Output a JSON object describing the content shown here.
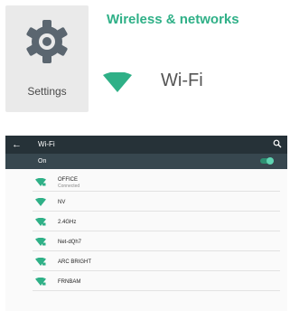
{
  "intro": {
    "settings_label": "Settings",
    "section_title": "Wireless & networks",
    "wifi_label": "Wi-Fi",
    "accent_color": "#2fb087"
  },
  "wifi_screen": {
    "title": "Wi-Fi",
    "toggle_label": "On",
    "toggle_on": true,
    "networks": [
      {
        "name": "OFFICE",
        "status": "Connected",
        "icon": "wifi-lock-icon"
      },
      {
        "name": "NV",
        "status": "",
        "icon": "wifi-icon"
      },
      {
        "name": "2.4GHz",
        "status": "",
        "icon": "wifi-lock-icon"
      },
      {
        "name": "Net-dQh7",
        "status": "",
        "icon": "wifi-lock-icon"
      },
      {
        "name": "ARC BRIGHT",
        "status": "",
        "icon": "wifi-lock-icon"
      },
      {
        "name": "FRNBAM",
        "status": "",
        "icon": "wifi-lock-icon"
      }
    ]
  }
}
